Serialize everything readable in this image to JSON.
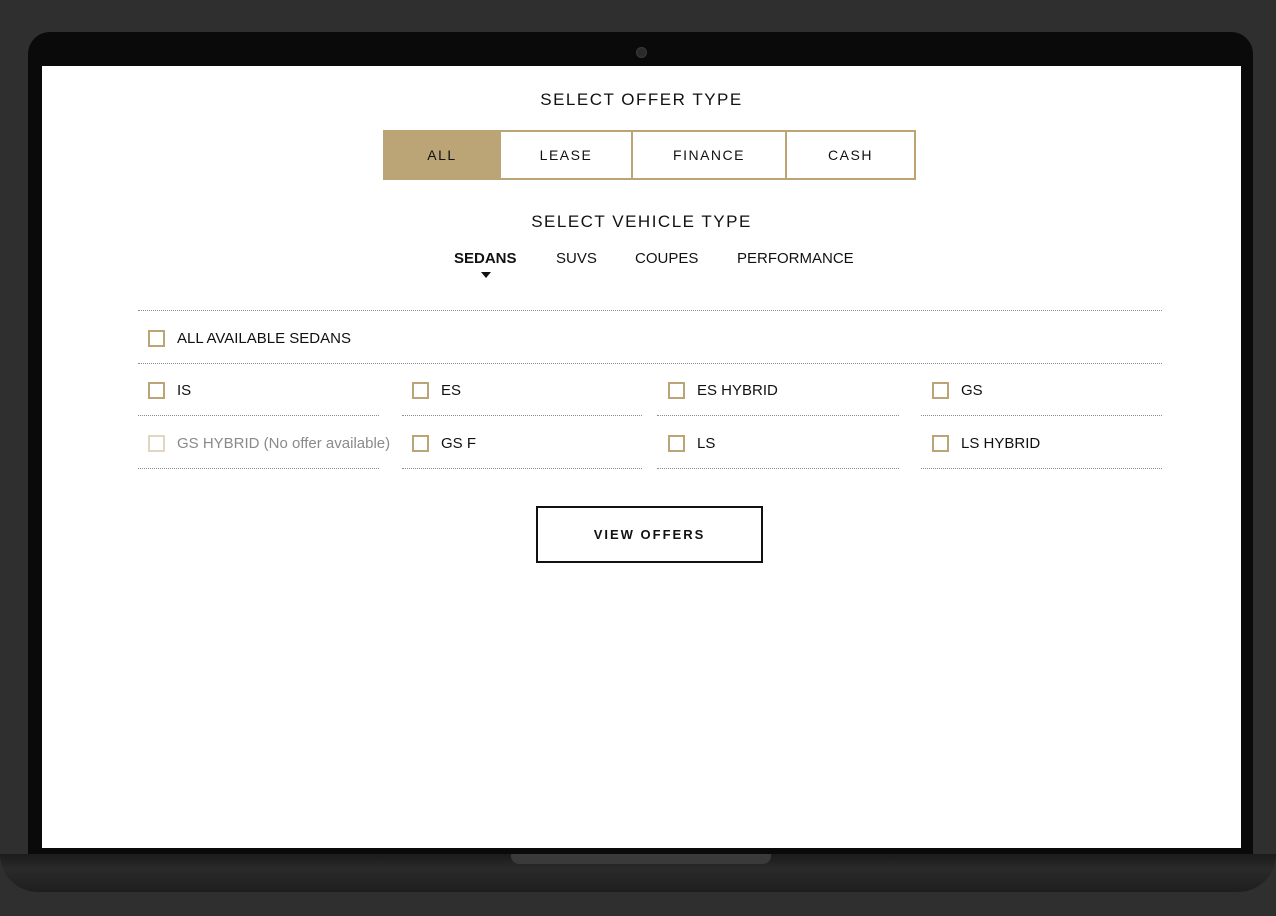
{
  "offer_section": {
    "title": "SELECT OFFER TYPE",
    "tabs": [
      {
        "label": "ALL",
        "active": true
      },
      {
        "label": "LEASE",
        "active": false
      },
      {
        "label": "FINANCE",
        "active": false
      },
      {
        "label": "CASH",
        "active": false
      }
    ]
  },
  "vehicle_section": {
    "title": "SELECT VEHICLE TYPE",
    "tabs": [
      {
        "label": "SEDANS",
        "active": true
      },
      {
        "label": "SUVS",
        "active": false
      },
      {
        "label": "COUPES",
        "active": false
      },
      {
        "label": "PERFORMANCE",
        "active": false
      }
    ]
  },
  "models": {
    "all_option": {
      "label": "ALL AVAILABLE SEDANS",
      "checked": false
    },
    "items": [
      {
        "label": "IS",
        "checked": false,
        "disabled": false
      },
      {
        "label": "ES",
        "checked": false,
        "disabled": false
      },
      {
        "label": "ES HYBRID",
        "checked": false,
        "disabled": false
      },
      {
        "label": "GS",
        "checked": false,
        "disabled": false
      },
      {
        "label": "GS HYBRID (No offer available)",
        "checked": false,
        "disabled": true
      },
      {
        "label": "GS F",
        "checked": false,
        "disabled": false
      },
      {
        "label": "LS",
        "checked": false,
        "disabled": false
      },
      {
        "label": "LS HYBRID",
        "checked": false,
        "disabled": false
      }
    ]
  },
  "cta": {
    "view_offers_label": "VIEW OFFERS"
  },
  "colors": {
    "accent_gold": "#bba476",
    "text": "#111111",
    "disabled_text": "#8a8a8a"
  }
}
